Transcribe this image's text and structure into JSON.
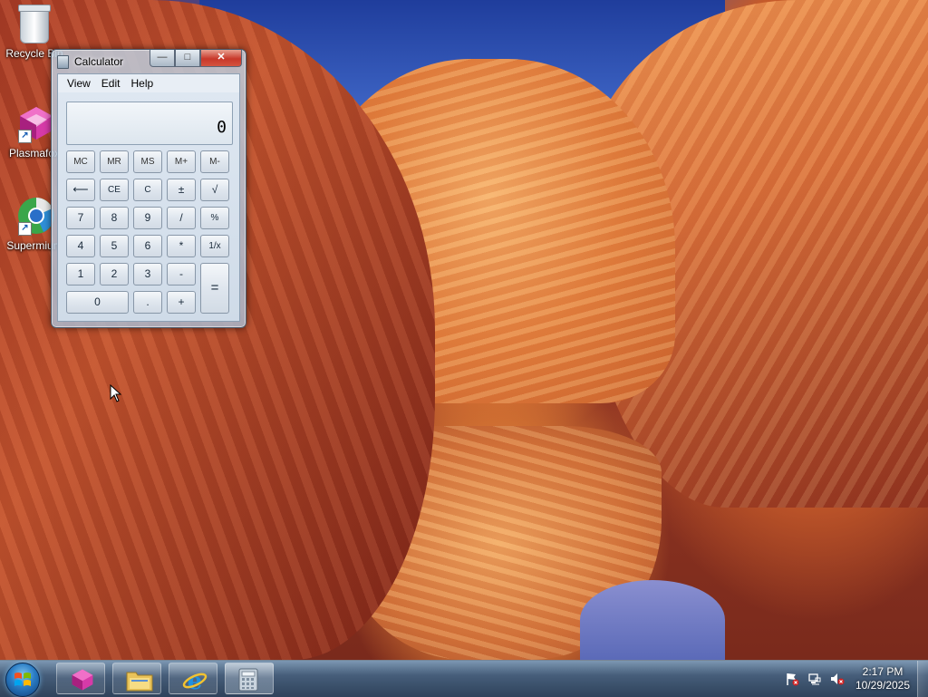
{
  "desktop": {
    "icons": [
      {
        "label": "Recycle Bin",
        "icon": "recycle-bin-icon"
      },
      {
        "label": "Plasmafox",
        "icon": "plasmafox-icon"
      },
      {
        "label": "Supermium",
        "icon": "supermium-icon"
      }
    ]
  },
  "calculator": {
    "title": "Calculator",
    "title_buttons": {
      "minimize": "—",
      "maximize": "□",
      "close": "✕"
    },
    "menu": [
      "View",
      "Edit",
      "Help"
    ],
    "display_value": "0",
    "keys": {
      "mc": "MC",
      "mr": "MR",
      "ms": "MS",
      "mplus": "M+",
      "mminus": "M-",
      "backspace": "⟵",
      "ce": "CE",
      "c": "C",
      "plusminus": "±",
      "sqrt": "√",
      "seven": "7",
      "eight": "8",
      "nine": "9",
      "divide": "/",
      "percent": "%",
      "four": "4",
      "five": "5",
      "six": "6",
      "multiply": "*",
      "reciprocal": "1/x",
      "one": "1",
      "two": "2",
      "three": "3",
      "minus": "-",
      "equals": "=",
      "zero": "0",
      "decimal": ".",
      "plus": "+"
    }
  },
  "taskbar": {
    "pinned": [
      {
        "name": "plasmafox",
        "icon": "plasmafox-icon"
      },
      {
        "name": "file-explorer",
        "icon": "folder-icon"
      },
      {
        "name": "internet-explorer",
        "icon": "ie-icon"
      },
      {
        "name": "calculator",
        "icon": "calculator-icon",
        "active": true
      }
    ],
    "tray_icons": [
      "action-center-flag-icon",
      "network-icon",
      "volume-muted-icon"
    ],
    "clock": {
      "time": "2:17 PM",
      "date": "10/29/2025"
    }
  }
}
